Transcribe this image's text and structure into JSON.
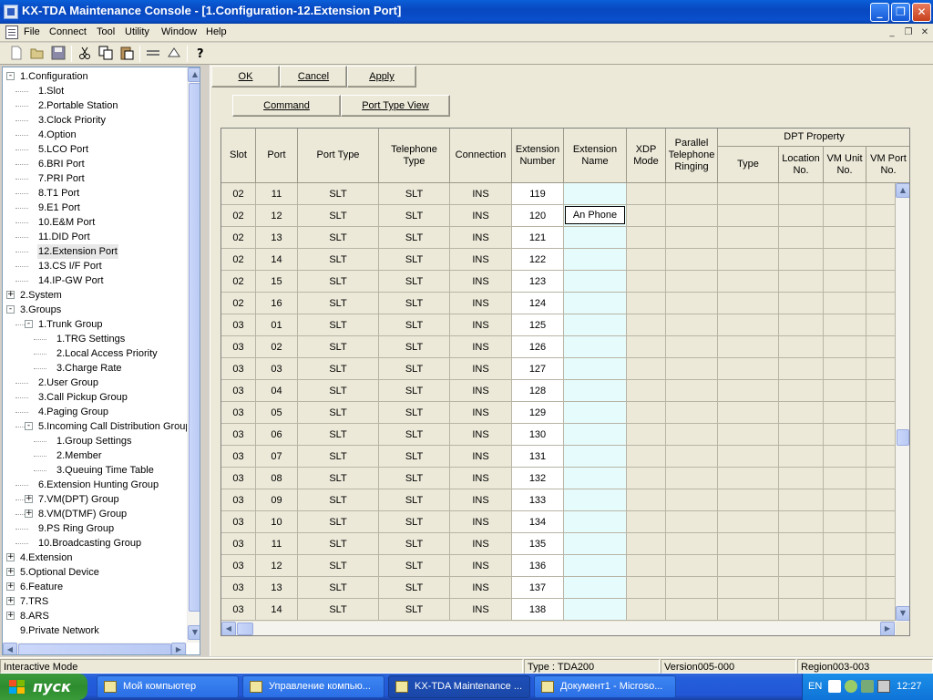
{
  "window": {
    "title": "KX-TDA Maintenance Console - [1.Configuration-12.Extension Port]"
  },
  "menu": [
    "File",
    "Connect",
    "Tool",
    "Utility",
    "Window",
    "Help"
  ],
  "toolbar_icons": [
    "new-icon",
    "open-icon",
    "save-icon",
    "cut-icon",
    "copy-icon",
    "paste-icon",
    "connect-icon",
    "disconnect-icon",
    "help-icon"
  ],
  "tree": [
    {
      "label": "1.Configuration",
      "level": 0,
      "expander": "-"
    },
    {
      "label": "1.Slot",
      "level": 1
    },
    {
      "label": "2.Portable Station",
      "level": 1
    },
    {
      "label": "3.Clock Priority",
      "level": 1
    },
    {
      "label": "4.Option",
      "level": 1
    },
    {
      "label": "5.LCO Port",
      "level": 1
    },
    {
      "label": "6.BRI Port",
      "level": 1
    },
    {
      "label": "7.PRI Port",
      "level": 1
    },
    {
      "label": "8.T1 Port",
      "level": 1
    },
    {
      "label": "9.E1 Port",
      "level": 1
    },
    {
      "label": "10.E&M Port",
      "level": 1
    },
    {
      "label": "11.DID Port",
      "level": 1
    },
    {
      "label": "12.Extension Port",
      "level": 1,
      "selected": true
    },
    {
      "label": "13.CS I/F Port",
      "level": 1
    },
    {
      "label": "14.IP-GW Port",
      "level": 1
    },
    {
      "label": "2.System",
      "level": 0,
      "expander": "+"
    },
    {
      "label": "3.Groups",
      "level": 0,
      "expander": "-"
    },
    {
      "label": "1.Trunk Group",
      "level": 1,
      "expander": "-"
    },
    {
      "label": "1.TRG Settings",
      "level": 2
    },
    {
      "label": "2.Local Access Priority",
      "level": 2
    },
    {
      "label": "3.Charge Rate",
      "level": 2
    },
    {
      "label": "2.User Group",
      "level": 1
    },
    {
      "label": "3.Call Pickup Group",
      "level": 1
    },
    {
      "label": "4.Paging Group",
      "level": 1
    },
    {
      "label": "5.Incoming Call Distribution Group",
      "level": 1,
      "expander": "-"
    },
    {
      "label": "1.Group Settings",
      "level": 2
    },
    {
      "label": "2.Member",
      "level": 2
    },
    {
      "label": "3.Queuing Time Table",
      "level": 2
    },
    {
      "label": "6.Extension Hunting Group",
      "level": 1
    },
    {
      "label": "7.VM(DPT) Group",
      "level": 1,
      "expander": "+"
    },
    {
      "label": "8.VM(DTMF) Group",
      "level": 1,
      "expander": "+"
    },
    {
      "label": "9.PS Ring Group",
      "level": 1
    },
    {
      "label": "10.Broadcasting Group",
      "level": 1
    },
    {
      "label": "4.Extension",
      "level": 0,
      "expander": "+"
    },
    {
      "label": "5.Optional Device",
      "level": 0,
      "expander": "+"
    },
    {
      "label": "6.Feature",
      "level": 0,
      "expander": "+"
    },
    {
      "label": "7.TRS",
      "level": 0,
      "expander": "+"
    },
    {
      "label": "8.ARS",
      "level": 0,
      "expander": "+"
    },
    {
      "label": "9.Private Network",
      "level": 0
    }
  ],
  "buttons": {
    "ok": "OK",
    "cancel": "Cancel",
    "apply": "Apply",
    "command": "Command",
    "port_type_view": "Port Type View"
  },
  "table": {
    "headers": {
      "slot": "Slot",
      "port": "Port",
      "port_type": "Port Type",
      "telephone_type": "Telephone Type",
      "connection": "Connection",
      "extension_number": "Extension Number",
      "extension_name": "Extension Name",
      "xdp_mode": "XDP Mode",
      "parallel_ringing": "Parallel Telephone Ringing",
      "dpt_property": "DPT Property",
      "type": "Type",
      "location_no": "Location No.",
      "vm_unit_no": "VM Unit No.",
      "vm_port_no": "VM Port No."
    },
    "rows": [
      [
        "02",
        "11",
        "SLT",
        "SLT",
        "INS",
        "119",
        ""
      ],
      [
        "02",
        "12",
        "SLT",
        "SLT",
        "INS",
        "120",
        "An Phone"
      ],
      [
        "02",
        "13",
        "SLT",
        "SLT",
        "INS",
        "121",
        ""
      ],
      [
        "02",
        "14",
        "SLT",
        "SLT",
        "INS",
        "122",
        ""
      ],
      [
        "02",
        "15",
        "SLT",
        "SLT",
        "INS",
        "123",
        ""
      ],
      [
        "02",
        "16",
        "SLT",
        "SLT",
        "INS",
        "124",
        ""
      ],
      [
        "03",
        "01",
        "SLT",
        "SLT",
        "INS",
        "125",
        ""
      ],
      [
        "03",
        "02",
        "SLT",
        "SLT",
        "INS",
        "126",
        ""
      ],
      [
        "03",
        "03",
        "SLT",
        "SLT",
        "INS",
        "127",
        ""
      ],
      [
        "03",
        "04",
        "SLT",
        "SLT",
        "INS",
        "128",
        ""
      ],
      [
        "03",
        "05",
        "SLT",
        "SLT",
        "INS",
        "129",
        ""
      ],
      [
        "03",
        "06",
        "SLT",
        "SLT",
        "INS",
        "130",
        ""
      ],
      [
        "03",
        "07",
        "SLT",
        "SLT",
        "INS",
        "131",
        ""
      ],
      [
        "03",
        "08",
        "SLT",
        "SLT",
        "INS",
        "132",
        ""
      ],
      [
        "03",
        "09",
        "SLT",
        "SLT",
        "INS",
        "133",
        ""
      ],
      [
        "03",
        "10",
        "SLT",
        "SLT",
        "INS",
        "134",
        ""
      ],
      [
        "03",
        "11",
        "SLT",
        "SLT",
        "INS",
        "135",
        ""
      ],
      [
        "03",
        "12",
        "SLT",
        "SLT",
        "INS",
        "136",
        ""
      ],
      [
        "03",
        "13",
        "SLT",
        "SLT",
        "INS",
        "137",
        ""
      ],
      [
        "03",
        "14",
        "SLT",
        "SLT",
        "INS",
        "138",
        ""
      ]
    ],
    "editing_row": 1
  },
  "status": {
    "mode": "Interactive Mode",
    "type": "Type : TDA200",
    "version": "Version005-000",
    "region": "Region003-003"
  },
  "taskbar": {
    "start": "пуск",
    "tasks": [
      {
        "label": "Мой компьютер",
        "active": false
      },
      {
        "label": "Управление компью...",
        "active": false
      },
      {
        "label": "KX-TDA Maintenance ...",
        "active": true
      },
      {
        "label": "Документ1 - Microso...",
        "active": false
      }
    ],
    "lang": "EN",
    "clock": "12:27"
  }
}
